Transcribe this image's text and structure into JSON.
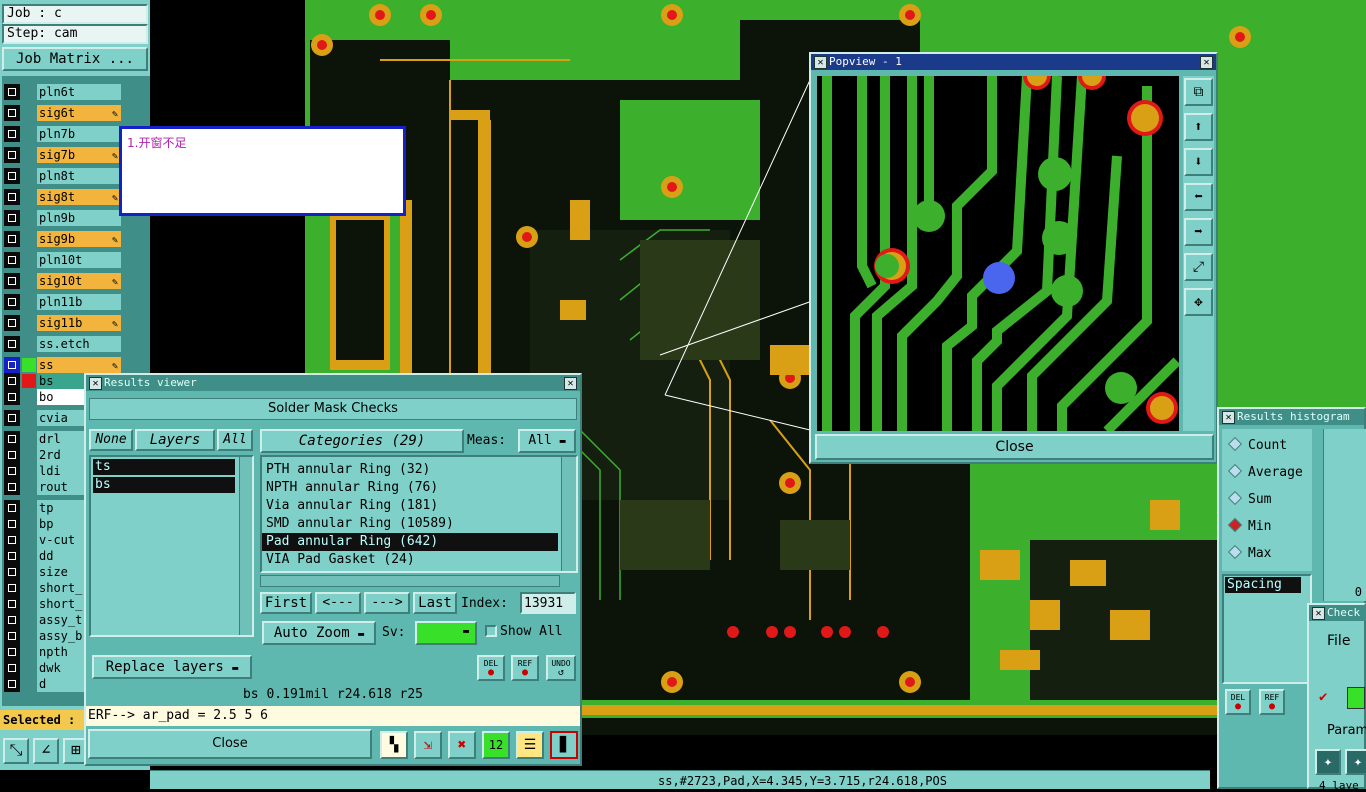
{
  "header": {
    "job": "Job : c",
    "step": "Step: cam",
    "job_matrix": "Job Matrix ..."
  },
  "layers": [
    {
      "name": "pln6t",
      "kind": "plane"
    },
    {
      "name": "sig6t",
      "kind": "signal"
    },
    {
      "name": "pln7b",
      "kind": "plane"
    },
    {
      "name": "sig7b",
      "kind": "signal"
    },
    {
      "name": "pln8t",
      "kind": "plane"
    },
    {
      "name": "sig8t",
      "kind": "signal"
    },
    {
      "name": "pln9b",
      "kind": "plane"
    },
    {
      "name": "sig9b",
      "kind": "signal"
    },
    {
      "name": "pln10t",
      "kind": "plane"
    },
    {
      "name": "sig10t",
      "kind": "signal"
    },
    {
      "name": "pln11b",
      "kind": "plane"
    },
    {
      "name": "sig11b",
      "kind": "signal"
    },
    {
      "name": "ss.etch",
      "kind": "plane"
    },
    {
      "name": "ss",
      "kind": "signal"
    },
    {
      "name": "bs",
      "kind": "teal"
    },
    {
      "name": "bo",
      "kind": "white"
    },
    {
      "name": "cvia",
      "kind": "plane"
    },
    {
      "name": "drl",
      "kind": "plane"
    },
    {
      "name": "2rd",
      "kind": "plane"
    },
    {
      "name": "ldi",
      "kind": "plane"
    },
    {
      "name": "rout",
      "kind": "plane"
    },
    {
      "name": "tp",
      "kind": "plane"
    },
    {
      "name": "bp",
      "kind": "plane"
    },
    {
      "name": "v-cut",
      "kind": "plane"
    },
    {
      "name": "dd",
      "kind": "plane"
    },
    {
      "name": "size",
      "kind": "plane"
    },
    {
      "name": "short_",
      "kind": "plane"
    },
    {
      "name": "short_",
      "kind": "plane"
    },
    {
      "name": "assy_t",
      "kind": "plane"
    },
    {
      "name": "assy_b",
      "kind": "plane"
    },
    {
      "name": "npth",
      "kind": "plane"
    },
    {
      "name": "dwk",
      "kind": "plane"
    },
    {
      "name": "d",
      "kind": "plane"
    }
  ],
  "selected_label": "Selected :",
  "note_text": "1.开窗不足",
  "results_viewer": {
    "title": "Results viewer",
    "heading": "Solder Mask Checks",
    "none_btn": "None",
    "layers_label": "Layers",
    "all_btn": "All",
    "layer_list": [
      "ts",
      "bs"
    ],
    "replace_layers": "Replace layers",
    "categories_label": "Categories (29)",
    "meas_label": "Meas:",
    "meas_value": "All",
    "categories": [
      "PTH annular Ring (32)",
      "NPTH annular Ring (76)",
      "Via annular Ring (181)",
      "SMD annular Ring (10589)",
      "Pad annular Ring (642)",
      "VIA Pad Gasket (24)"
    ],
    "selected_category_index": 4,
    "first_btn": "First",
    "prev_btn": "<---",
    "next_btn": "--->",
    "last_btn": "Last",
    "index_label": "Index:",
    "index_value": "13931",
    "auto_zoom": "Auto Zoom",
    "sv_label": "Sv:",
    "show_all": "Show All",
    "del_btn": "DEL",
    "ref_btn": "REF",
    "undo_btn": "UNDO",
    "status": "bs 0.191mil  r24.618  r25",
    "erf": "ERF--> ar_pad = 2.5 5 6",
    "close": "Close"
  },
  "popview": {
    "title": "Popview - 1",
    "close": "Close"
  },
  "histogram": {
    "title": "Results histogram",
    "options": [
      {
        "label": "Count",
        "selected": false
      },
      {
        "label": "Average",
        "selected": false
      },
      {
        "label": "Sum",
        "selected": false
      },
      {
        "label": "Min",
        "selected": true
      },
      {
        "label": "Max",
        "selected": false
      }
    ],
    "spacing": "Spacing",
    "zero": "0",
    "del_btn": "DEL",
    "ref_btn": "REF"
  },
  "check_window": {
    "title": "Check",
    "file_menu": "File",
    "param_label": "Param",
    "layer_text": "4 laye"
  },
  "status_bar": "ss,#2723,Pad,X=4.345,Y=3.715,r24.618,POS",
  "colors": {
    "pcb_green": "#3cb02c",
    "copper": "#d9a015",
    "pad_red": "#e01818",
    "highlight_pad": "#4a66ee",
    "panel": "#7fd0c8"
  }
}
